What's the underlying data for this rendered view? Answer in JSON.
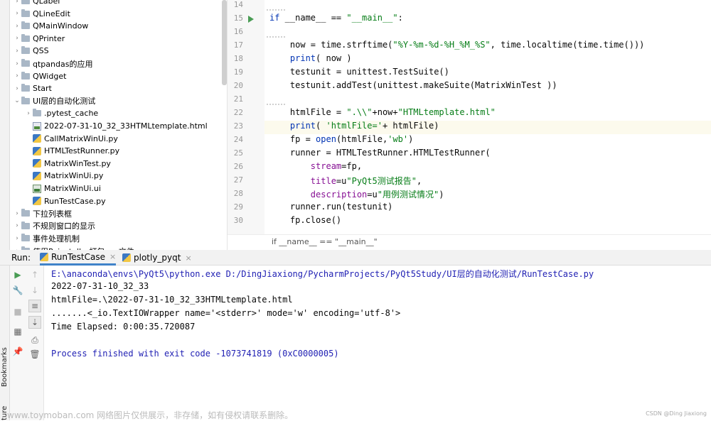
{
  "left_strip": {
    "bookmarks_label": "Bookmarks",
    "structure_label": "ture"
  },
  "tree": {
    "items": [
      {
        "label": "QLabel",
        "kind": "folder"
      },
      {
        "label": "QLineEdit",
        "kind": "folder"
      },
      {
        "label": "QMainWindow",
        "kind": "folder"
      },
      {
        "label": "QPrinter",
        "kind": "folder"
      },
      {
        "label": "QSS",
        "kind": "folder"
      },
      {
        "label": "qtpandas的应用",
        "kind": "folder"
      },
      {
        "label": "QWidget",
        "kind": "folder"
      },
      {
        "label": "Start",
        "kind": "folder"
      },
      {
        "label": "UI层的自动化测试",
        "kind": "folder-open"
      },
      {
        "label": ".pytest_cache",
        "kind": "folder"
      },
      {
        "label": "2022-07-31-10_32_33HTMLtemplate.html",
        "kind": "html"
      },
      {
        "label": "CallMatrixWinUi.py",
        "kind": "py"
      },
      {
        "label": "HTMLTestRunner.py",
        "kind": "py"
      },
      {
        "label": "MatrixWinTest.py",
        "kind": "py"
      },
      {
        "label": "MatrixWinUi.py",
        "kind": "py"
      },
      {
        "label": "MatrixWinUi.ui",
        "kind": "ui"
      },
      {
        "label": "RunTestCase.py",
        "kind": "py"
      },
      {
        "label": "下拉列表框",
        "kind": "folder"
      },
      {
        "label": "不规则窗口的显示",
        "kind": "folder"
      },
      {
        "label": "事件处理机制",
        "kind": "folder"
      },
      {
        "label": "使用Pyinstaller打包exe文件",
        "kind": "folder"
      }
    ]
  },
  "editor": {
    "line_numbers": [
      "14",
      "15",
      "16",
      "17",
      "18",
      "19",
      "20",
      "21",
      "22",
      "23",
      "24",
      "25",
      "26",
      "27",
      "28",
      "29",
      "30"
    ],
    "code": {
      "l15_kw": "if",
      "l15_mid": " __name__ == ",
      "l15_str": "\"__main__\"",
      "l15_end": ":",
      "l17_a": "    now = time.strftime(",
      "l17_str": "\"%Y-%m-%d-%H_%M_%S\"",
      "l17_b": ", time.localtime(time.time()))",
      "l18_kw": "print",
      "l18_b": "( now )",
      "l19": "    testunit = unittest.TestSuite()",
      "l20": "    testunit.addTest(unittest.makeSuite(MatrixWinTest ))",
      "l22_a": "    htmlFile = ",
      "l22_s1": "\".\\\\\"",
      "l22_b": "+now+",
      "l22_s2": "\"HTMLtemplate.html\"",
      "l23_kw": "print",
      "l23_b": "( ",
      "l23_str": "'htmlFile='",
      "l23_c": "+ htmlFile)",
      "l24_a": "    fp = ",
      "l24_kw": "open",
      "l24_b": "(htmlFile,",
      "l24_str": "'wb'",
      "l24_c": ")",
      "l25": "    runner = HTMLTestRunner.HTMLTestRunner(",
      "l26_p": "stream",
      "l26_b": "=fp,",
      "l27_p": "title",
      "l27_b": "=u",
      "l27_str": "\"PyQt5测试报告\"",
      "l27_c": ",",
      "l28_p": "description",
      "l28_b": "=u",
      "l28_str": "\"用例测试情况\"",
      "l28_c": ")",
      "l29": "    runner.run(testunit)",
      "l30": "    fp.close()"
    },
    "breadcrumb": "if __name__ == \"__main__\""
  },
  "run": {
    "label": "Run:",
    "tabs": [
      {
        "label": "RunTestCase",
        "close": "×"
      },
      {
        "label": "plotly_pyqt",
        "close": "×"
      }
    ]
  },
  "console": {
    "lines": [
      "E:\\anaconda\\envs\\PyQt5\\python.exe D:/DingJiaxiong/PycharmProjects/PyQt5Study/UI层的自动化测试/RunTestCase.py",
      "2022-07-31-10_32_33",
      "htmlFile=.\\2022-07-31-10_32_33HTMLtemplate.html",
      ".......<_io.TextIOWrapper name='<stderr>' mode='w' encoding='utf-8'>",
      "Time Elapsed: 0:00:35.720087",
      "",
      "Process finished with exit code -1073741819 (0xC0000005)"
    ],
    "colors": {
      "path": "#1f1fb3",
      "finish": "#1f1fb3"
    }
  },
  "watermark": {
    "left": "www.toymoban.com 网络图片仅供展示，非存储，如有侵权请联系删除。",
    "right": "CSDN @Ding Jiaxiong"
  }
}
